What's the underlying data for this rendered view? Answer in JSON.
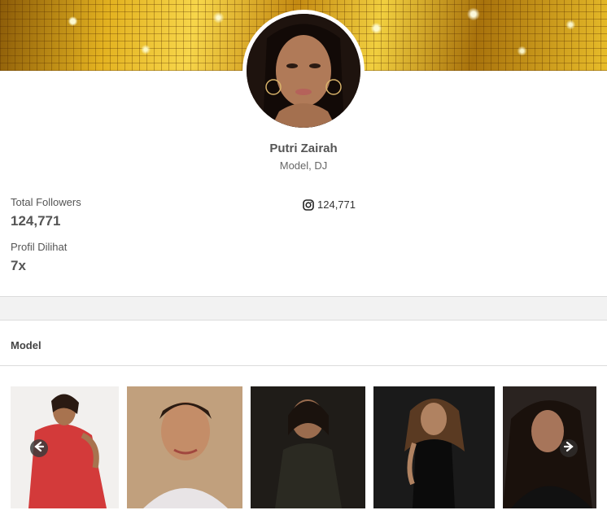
{
  "profile": {
    "name": "Putri Zairah",
    "role": "Model, DJ"
  },
  "stats": {
    "followers_label": "Total Followers",
    "followers_value": "124,771",
    "views_label": "Profil Dilihat",
    "views_value": "7x"
  },
  "instagram": {
    "icon": "instagram-icon",
    "count": "124,771"
  },
  "section": {
    "title": "Model"
  },
  "gallery": {
    "items": [
      {
        "name": "gallery-photo-1",
        "bg": "#f2f0ee",
        "accent": "#d33a3a"
      },
      {
        "name": "gallery-photo-2",
        "bg": "#b89a7a",
        "accent": "#e8e4e6"
      },
      {
        "name": "gallery-photo-3",
        "bg": "#1f1c18",
        "accent": "#2b2a22"
      },
      {
        "name": "gallery-photo-4",
        "bg": "#141414",
        "accent": "#0b0b0b"
      },
      {
        "name": "gallery-photo-5",
        "bg": "#2a2320",
        "accent": "#111111"
      }
    ],
    "prev_icon": "arrow-left-icon",
    "next_icon": "arrow-right-icon"
  },
  "colors": {
    "banner_gold": "#e3b220",
    "text": "#555555",
    "divider": "#dcdcdc",
    "band": "#f2f2f2"
  }
}
